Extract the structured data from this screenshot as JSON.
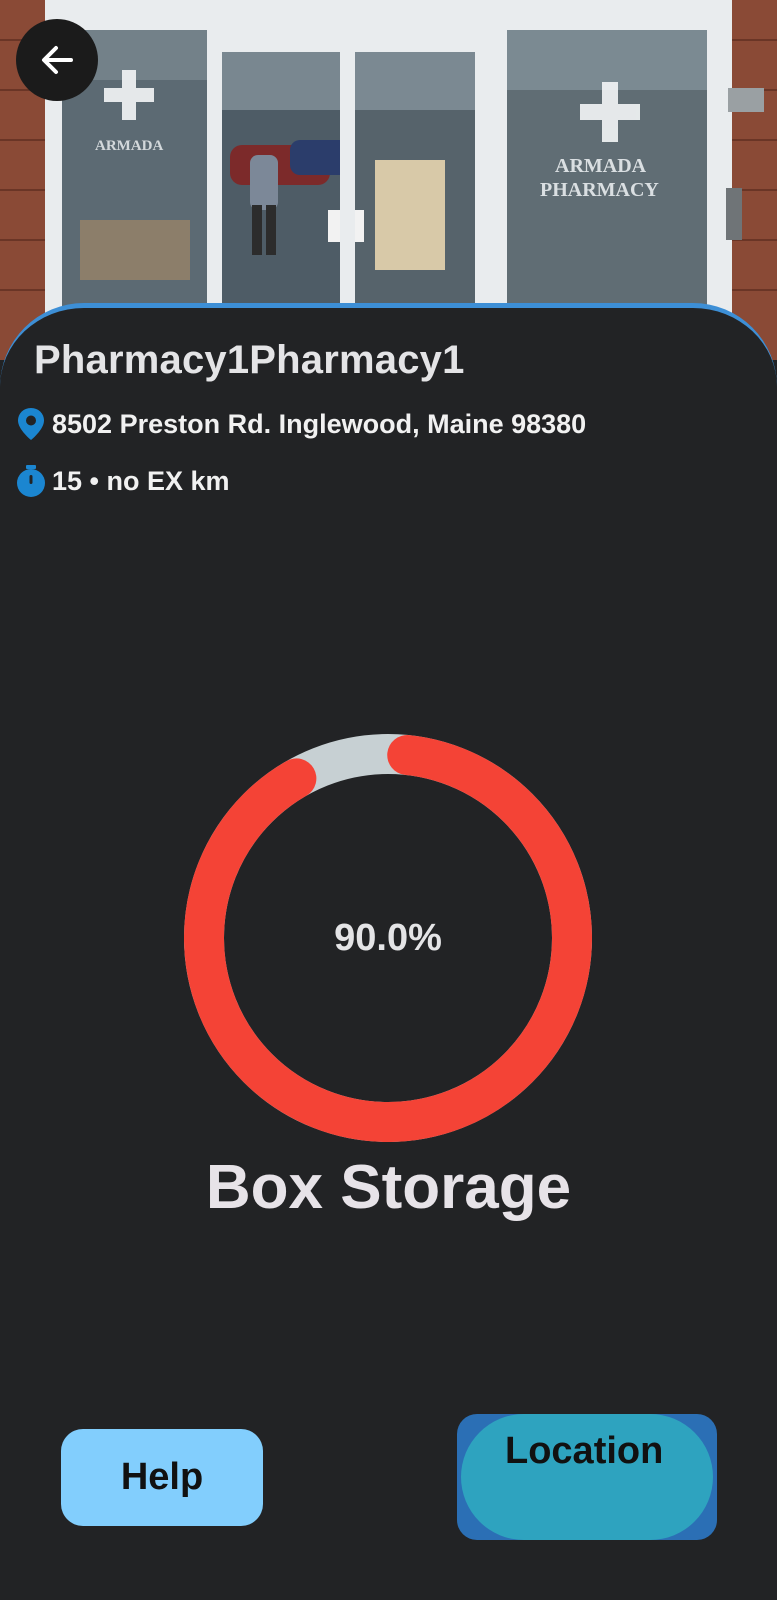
{
  "header": {
    "back_icon": "arrow-left-icon",
    "photo_sign_text": "ARMADA PHARMACY"
  },
  "pharmacy": {
    "name": "Pharmacy1Pharmacy1",
    "address": "8502 Preston Rd. Inglewood, Maine 98380",
    "address_icon": "map-pin-icon",
    "time_distance": "15 • no EX km",
    "time_icon": "stopwatch-icon"
  },
  "storage": {
    "percent_label": "90.0%",
    "fill_fraction": 0.9,
    "label": "Box Storage"
  },
  "actions": {
    "help_label": "Help",
    "location_label": "Location"
  },
  "colors": {
    "ring_fill": "#f44336",
    "ring_track": "#c7d0d3",
    "accent_blue": "#1b86d1",
    "help_bg": "#82cefd",
    "location_bg": "#2ea3bf"
  }
}
